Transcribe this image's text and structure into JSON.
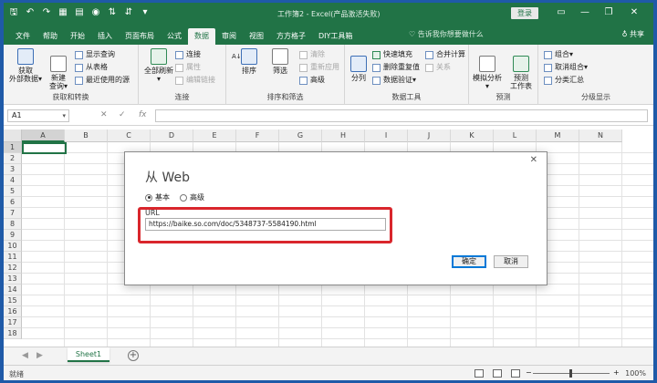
{
  "titlebar": {
    "title": "工作簿2 - Excel(产品激活失败)",
    "login": "登录",
    "qa_icons": [
      "save-icon",
      "undo-icon",
      "redo-icon",
      "table-icon",
      "form-icon",
      "camera-icon",
      "sort-az-icon",
      "sort-za-icon",
      "customize-icon"
    ],
    "min": "—",
    "restore": "❐",
    "close": "✕"
  },
  "tabs": [
    "文件",
    "帮助",
    "开始",
    "插入",
    "页面布局",
    "公式",
    "数据",
    "审阅",
    "视图",
    "方方格子",
    "DIY工具箱"
  ],
  "active_tab": "数据",
  "search_text": "♡ 告诉我你想要做什么",
  "share_label": "♁ 共享",
  "ribbon": {
    "get_data": {
      "label_1": "获取",
      "label_2": "外部数据▾",
      "new_query_1": "新建",
      "new_query_2": "查询▾",
      "show_query": "显示查询",
      "from_table": "从表格",
      "recent_sources": "最近使用的源",
      "group": "获取和转换"
    },
    "connections": {
      "refresh_all_1": "全部刷新",
      "refresh_all_2": "▾",
      "conn": "连接",
      "props": "属性",
      "edit_links": "编辑链接",
      "group": "连接"
    },
    "sort_filter": {
      "sort_az": "A↓Z",
      "sort": "排序",
      "filter": "筛选",
      "clear": "清除",
      "reapply": "重新应用",
      "advanced": "高级",
      "group": "排序和筛选"
    },
    "data_tools": {
      "split": "分列",
      "flash_fill": "快速填充",
      "remove_dup": "删除重复值",
      "validation": "数据验证▾",
      "consolidate": "合并计算",
      "relations": "关系",
      "group": "数据工具"
    },
    "forecast": {
      "whatif_1": "模拟分析",
      "whatif_2": "▾",
      "sheet_1": "预测",
      "sheet_2": "工作表",
      "group": "预测"
    },
    "outline": {
      "group_btn": "组合▾",
      "ungroup": "取消组合▾",
      "subtotal": "分类汇总",
      "group": "分级显示"
    }
  },
  "formula_bar": {
    "cell_ref": "A1",
    "dropdown": "▾",
    "cancel": "✕",
    "enter": "✓",
    "fx": "fx",
    "formula": ""
  },
  "columns": [
    "A",
    "B",
    "C",
    "D",
    "E",
    "F",
    "G",
    "H",
    "I",
    "J",
    "K",
    "L",
    "M",
    "N"
  ],
  "rows": [
    "1",
    "2",
    "3",
    "4",
    "5",
    "6",
    "7",
    "8",
    "9",
    "10",
    "11",
    "12",
    "13",
    "14",
    "15",
    "16",
    "17",
    "18"
  ],
  "sheet": {
    "tab": "Sheet1",
    "add": "+",
    "nav_prev": "◀",
    "nav_next": "▶"
  },
  "status": {
    "ready": "就绪",
    "zoom_out": "−",
    "zoom_in": "+",
    "zoom": "100%"
  },
  "dialog": {
    "title": "从 Web",
    "close": "✕",
    "radio_basic": "基本",
    "radio_advanced": "高级",
    "url_label": "URL",
    "url_value": "https://baike.so.com/doc/5348737-5584190.html",
    "ok": "确定",
    "cancel": "取消"
  }
}
